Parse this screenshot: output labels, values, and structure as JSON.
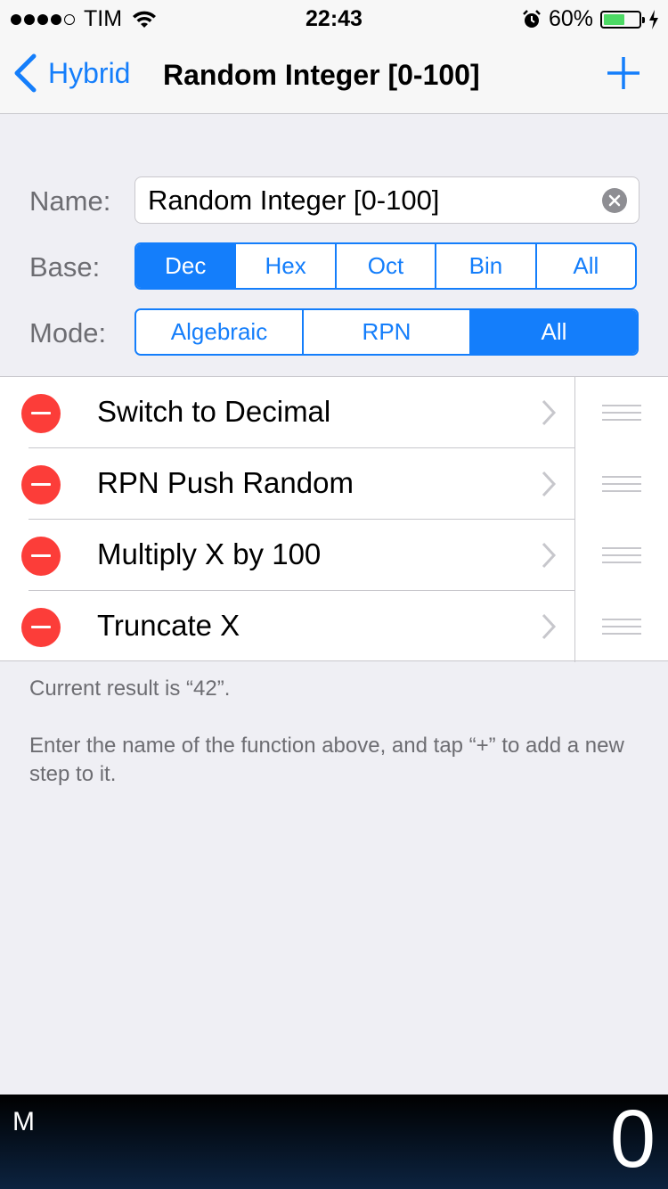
{
  "status_bar": {
    "carrier": "TIM",
    "time": "22:43",
    "battery": "60%",
    "battery_level": 0.6,
    "signal_bars_filled": 4,
    "signal_bars_total": 5
  },
  "nav": {
    "back_label": "Hybrid",
    "title": "Random Integer [0-100]"
  },
  "form": {
    "name_label": "Name:",
    "name_value": "Random Integer [0-100]",
    "base_label": "Base:",
    "base_options": [
      "Dec",
      "Hex",
      "Oct",
      "Bin",
      "All"
    ],
    "base_selected": "Dec",
    "mode_label": "Mode:",
    "mode_options": [
      "Algebraic",
      "RPN",
      "All"
    ],
    "mode_selected": "All"
  },
  "steps": [
    {
      "label": "Switch to Decimal"
    },
    {
      "label": "RPN Push Random"
    },
    {
      "label": "Multiply X by 100"
    },
    {
      "label": "Truncate X"
    }
  ],
  "footer": {
    "result": "Current result is “42”.",
    "hint": "Enter the name of the function above, and tap “+” to add a new step to it."
  },
  "bottom_bar": {
    "mode": "M",
    "display": "0"
  },
  "colors": {
    "accent": "#147efb",
    "delete": "#fc3d39",
    "battery": "#4cd964"
  }
}
